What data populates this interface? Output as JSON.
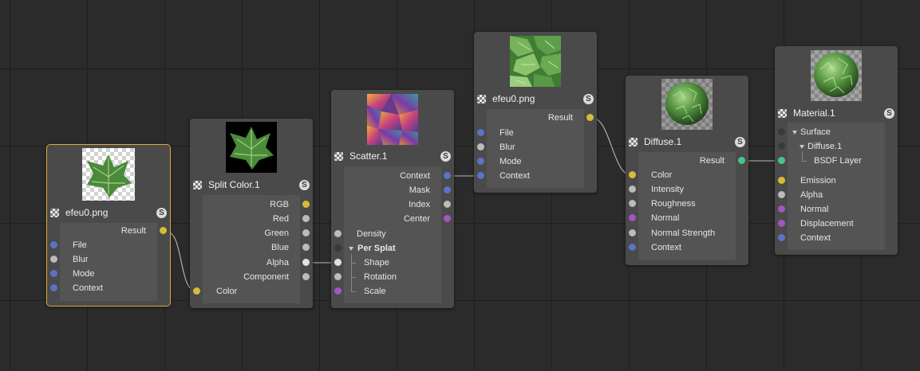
{
  "colors": {
    "background": "#2b2b2b",
    "node_header": "#4a4a4a",
    "node_body": "#545454",
    "selection": "#e2a93a",
    "port_blue": "#5b73c6",
    "port_yellow": "#d9bb3a",
    "port_gray": "#bbbbbb",
    "port_purple": "#a156c0",
    "port_green": "#49c487"
  },
  "nodes": {
    "efeu_a": {
      "title": "efeu0.png",
      "badge": "S",
      "thumbnail": "ivy-leaf-transparent",
      "outputs": [
        "Result"
      ],
      "inputs": [
        "File",
        "Blur",
        "Mode",
        "Context"
      ]
    },
    "split": {
      "title": "Split Color.1",
      "badge": "S",
      "thumbnail": "ivy-leaf-on-black",
      "outputs": [
        "RGB",
        "Red",
        "Green",
        "Blue",
        "Alpha",
        "Component"
      ],
      "inputs": [
        "Color"
      ]
    },
    "scatter": {
      "title": "Scatter.1",
      "badge": "S",
      "thumbnail": "scatter-gradient-pattern",
      "outputs": [
        "Context",
        "Mask",
        "Index",
        "Center"
      ],
      "inputs": [
        "Density",
        "Per Splat",
        "Shape",
        "Rotation",
        "Scale"
      ]
    },
    "efeu_b": {
      "title": "efeu0.png",
      "badge": "S",
      "thumbnail": "ivy-leaf-texture",
      "outputs": [
        "Result"
      ],
      "inputs": [
        "File",
        "Blur",
        "Mode",
        "Context"
      ]
    },
    "diffuse": {
      "title": "Diffuse.1",
      "badge": "S",
      "thumbnail": "ivy-sphere-preview",
      "outputs": [
        "Result"
      ],
      "inputs": [
        "Color",
        "Intensity",
        "Roughness",
        "Normal",
        "Normal Strength",
        "Context"
      ]
    },
    "material": {
      "title": "Material.1",
      "badge": "S",
      "thumbnail": "ivy-sphere-material",
      "inputs": [
        "Surface",
        "Diffuse.1",
        "BSDF Layer",
        "Emission",
        "Alpha",
        "Normal",
        "Displacement",
        "Context"
      ]
    }
  }
}
